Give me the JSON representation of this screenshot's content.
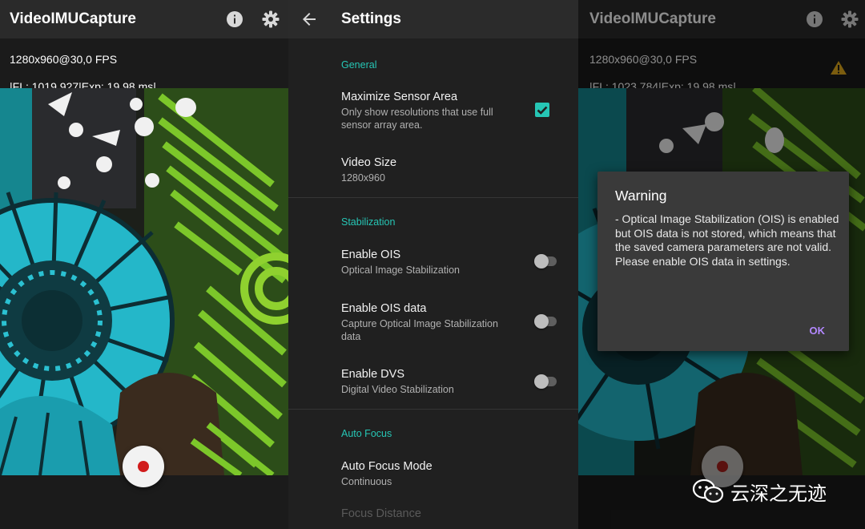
{
  "left": {
    "app_title": "VideoIMUCapture",
    "resolution_info": "1280x960@30,0 FPS",
    "camera_info": "|FL: 1019,927|Exp: 19,98 ms|",
    "icons": [
      "info-icon",
      "gear-icon"
    ],
    "record_button": "record"
  },
  "settings": {
    "title": "Settings",
    "back_icon": "arrow-left-icon",
    "sections": {
      "general": "General",
      "stabilization": "Stabilization",
      "auto_focus": "Auto Focus"
    },
    "items": {
      "maximize_sensor": {
        "title": "Maximize Sensor Area",
        "summary": "Only show resolutions that use full sensor array area.",
        "checked": true
      },
      "video_size": {
        "title": "Video Size",
        "summary": "1280x960"
      },
      "enable_ois": {
        "title": "Enable OIS",
        "summary": "Optical Image Stabilization",
        "on": false
      },
      "enable_ois_data": {
        "title": "Enable OIS data",
        "summary": "Capture Optical Image Stabilization data",
        "on": false
      },
      "enable_dvs": {
        "title": "Enable DVS",
        "summary": "Digital Video Stabilization",
        "on": false
      },
      "auto_focus_mode": {
        "title": "Auto Focus Mode",
        "summary": "Continuous"
      },
      "focus_distance": {
        "title": "Focus Distance"
      }
    },
    "accent": "#26c6b5"
  },
  "right": {
    "app_title": "VideoIMUCapture",
    "resolution_info": "1280x960@30,0 FPS",
    "camera_info": "|FL: 1023,784|Exp: 19,98 ms|",
    "dialog": {
      "title": "Warning",
      "message": "- Optical Image Stabilization (OIS) is enabled but OIS data is not stored, which means that the saved camera parameters are not valid. Please enable OIS data in settings.",
      "ok_label": "OK"
    },
    "warning_icon": "warning-icon"
  },
  "watermark": {
    "text": "云深之无迹",
    "icon": "wechat-icon"
  }
}
